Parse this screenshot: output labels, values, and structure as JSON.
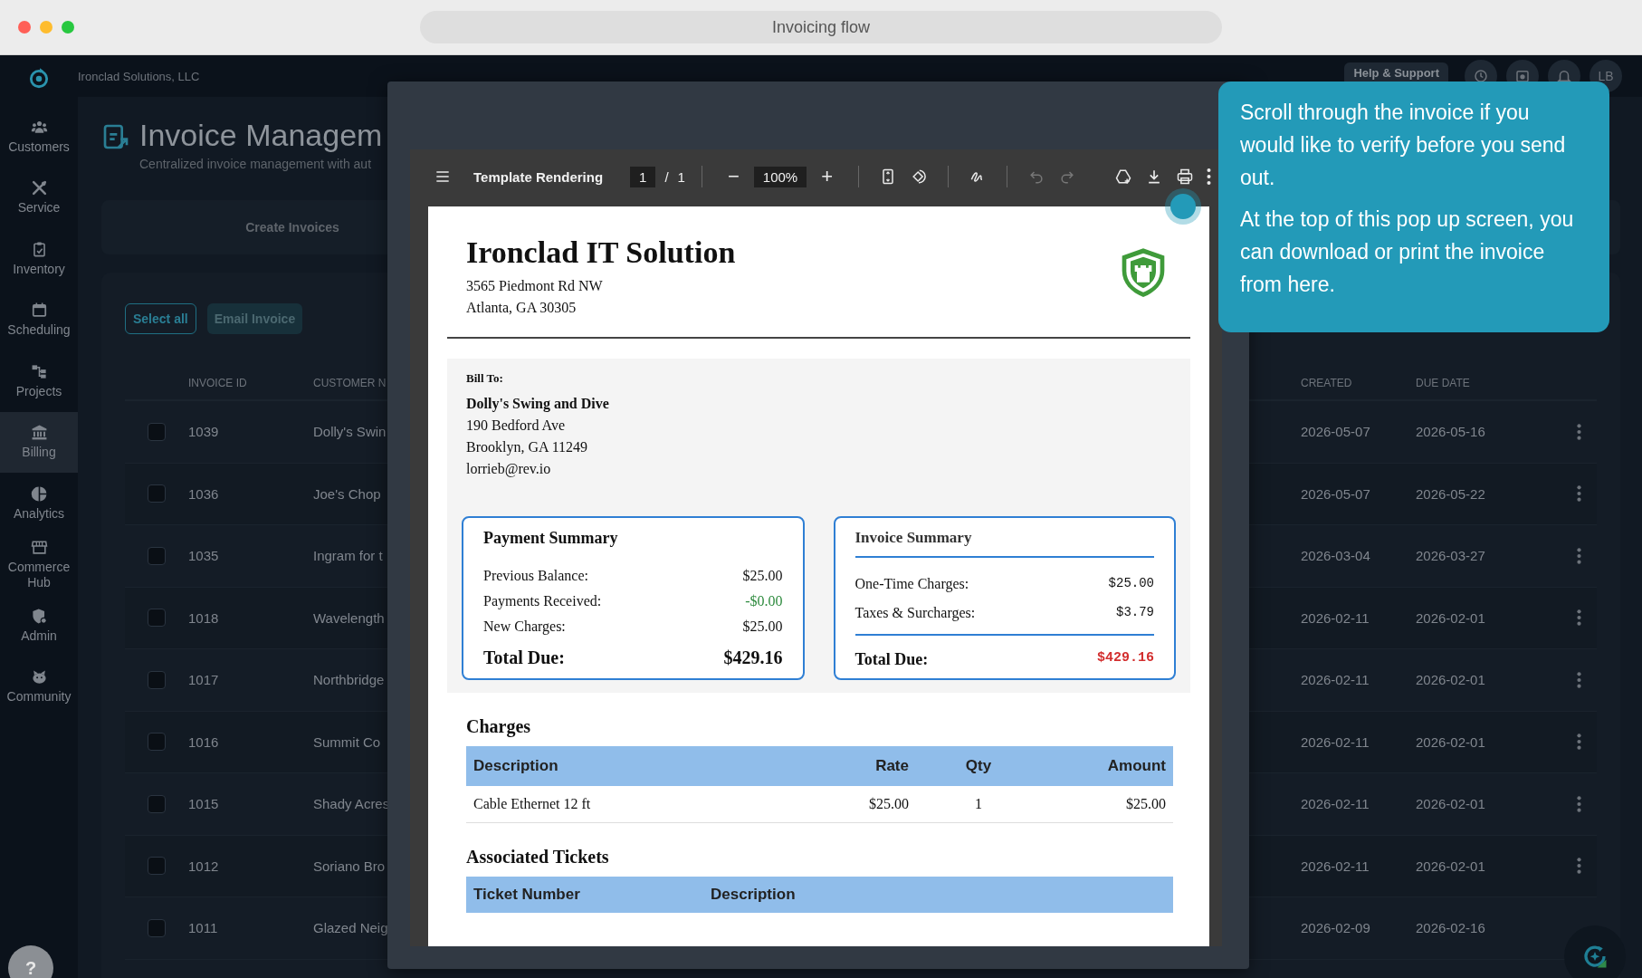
{
  "browser": {
    "title": "Invoicing flow"
  },
  "topbar": {
    "org": "Ironclad Solutions, LLC",
    "help_button": "Help & Support",
    "avatar": "LB"
  },
  "sidebar": {
    "items": [
      {
        "label": "Customers",
        "selected": false
      },
      {
        "label": "Service",
        "selected": false
      },
      {
        "label": "Inventory",
        "selected": false
      },
      {
        "label": "Scheduling",
        "selected": false
      },
      {
        "label": "Projects",
        "selected": false
      },
      {
        "label": "Billing",
        "selected": true
      },
      {
        "label": "Analytics",
        "selected": false
      },
      {
        "label": "Commerce Hub",
        "selected": false
      },
      {
        "label": "Admin",
        "selected": false
      },
      {
        "label": "Community",
        "selected": false
      }
    ],
    "help": "?"
  },
  "page_header": {
    "title": "Invoice Managem",
    "subtitle": "Centralized invoice management with aut"
  },
  "tabs": [
    {
      "label": "Create Invoices"
    }
  ],
  "actions": [
    {
      "label": "Select all",
      "kind": "outline"
    },
    {
      "label": "Email Invoice",
      "kind": "filled"
    }
  ],
  "table": {
    "columns": [
      "INVOICE ID",
      "CUSTOMER N",
      "CREATED",
      "DUE DATE"
    ],
    "rows": [
      {
        "id": "1039",
        "customer": "Dolly's Swin",
        "created": "2026-05-07",
        "due": "2026-05-16",
        "checked": false
      },
      {
        "id": "1036",
        "customer": "Joe's Chop",
        "created": "2026-05-07",
        "due": "2026-05-22",
        "checked": false
      },
      {
        "id": "1035",
        "customer": "Ingram for t",
        "created": "2026-03-04",
        "due": "2026-03-27",
        "checked": false
      },
      {
        "id": "1018",
        "customer": "Wavelength",
        "created": "2026-02-11",
        "due": "2026-02-01",
        "checked": false
      },
      {
        "id": "1017",
        "customer": "Northbridge",
        "created": "2026-02-11",
        "due": "2026-02-01",
        "checked": false
      },
      {
        "id": "1016",
        "customer": "Summit Co",
        "created": "2026-02-11",
        "due": "2026-02-01",
        "checked": false
      },
      {
        "id": "1015",
        "customer": "Shady Acres",
        "created": "2026-02-11",
        "due": "2026-02-01",
        "checked": false
      },
      {
        "id": "1012",
        "customer": "Soriano Bro",
        "created": "2026-02-11",
        "due": "2026-02-01",
        "checked": false
      },
      {
        "id": "1011",
        "customer": "Glazed Neig",
        "created": "2026-02-09",
        "due": "2026-02-16",
        "checked": false
      }
    ]
  },
  "modal": {
    "viewer": {
      "title": "Template Rendering",
      "page": "1",
      "separator": "/",
      "pages": "1",
      "zoom_out": "−",
      "zoom": "100%",
      "zoom_in": "+",
      "undo_enabled": false,
      "redo_enabled": false
    },
    "document": {
      "company": "Ironclad IT Solution",
      "address_lines": [
        "3565 Piedmont Rd NW",
        "Atlanta, GA 30305"
      ],
      "bill_to": {
        "label": "Bill To:",
        "name": "Dolly's Swing and Dive",
        "lines": [
          "190 Bedford Ave",
          "Brooklyn, GA 11249",
          "lorrieb@rev.io"
        ]
      },
      "payment_summary": {
        "title": "Payment Summary",
        "lines": [
          {
            "label": "Previous Balance:",
            "amount": "$25.00",
            "color": "#111111"
          },
          {
            "label": "Payments Received:",
            "amount": "-$0.00",
            "color": "#2e8b3e"
          },
          {
            "label": "New Charges:",
            "amount": "$25.00",
            "color": "#111111"
          }
        ],
        "total": {
          "label": "Total Due:",
          "amount": "$429.16",
          "color": "#111111"
        }
      },
      "invoice_summary": {
        "title": "Invoice Summary",
        "lines": [
          {
            "label": "One-Time Charges:",
            "amount": "$25.00",
            "color": "#111111"
          },
          {
            "label": "Taxes & Surcharges:",
            "amount": "$3.79",
            "color": "#111111"
          }
        ],
        "total": {
          "label": "Total Due:",
          "amount": "$429.16",
          "color": "#d32f2f"
        }
      },
      "charges": {
        "title": "Charges",
        "columns": [
          "Description",
          "Rate",
          "Qty",
          "Amount"
        ],
        "rows": [
          [
            "Cable Ethernet 12 ft",
            "$25.00",
            "1",
            "$25.00"
          ]
        ]
      },
      "tickets": {
        "title": "Associated Tickets",
        "columns": [
          "Ticket Number",
          "Description"
        ]
      }
    }
  },
  "tooltip": {
    "paragraphs": [
      "Scroll through the invoice if you would like to verify before you send out.",
      "At the top of this pop up screen, you can download or print the invoice from here."
    ]
  }
}
